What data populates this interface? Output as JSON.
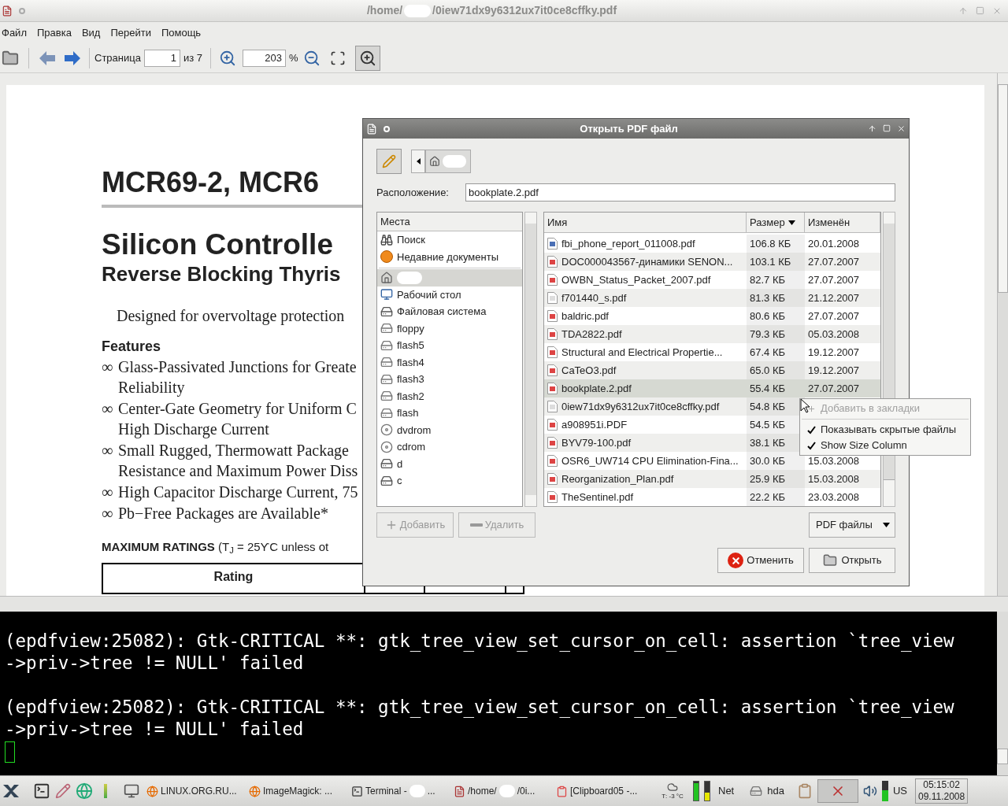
{
  "window": {
    "title_parts": [
      "/home/",
      "/0iew71dx9y6312ux7it0ce8cffky.pdf"
    ]
  },
  "menu": [
    "Файл",
    "Правка",
    "Вид",
    "Перейти",
    "Помощь"
  ],
  "toolbar": {
    "nav": [
      {
        "kind": "back",
        "disabled": true
      },
      {
        "kind": "forward",
        "disabled": false
      }
    ],
    "page_label": "Страница",
    "page": "1",
    "page_total": "из 7",
    "zoom": "203",
    "zoom_unit": "%",
    "fit": [
      {
        "kind": "page",
        "on": false
      },
      {
        "kind": "width",
        "on": true
      }
    ]
  },
  "document": {
    "heading": "MCR69-2, MCR6",
    "title": "Silicon Controlle",
    "subtitle": "Reverse Blocking Thyris",
    "intro": "Designed for overvoltage protection",
    "features_title": "Features",
    "features": [
      {
        "marker": "∞",
        "lines": [
          "Glass-Passivated Junctions for Greate",
          "Reliability"
        ]
      },
      {
        "marker": "∞",
        "lines": [
          "Center-Gate Geometry for Uniform C",
          "High Discharge Current"
        ]
      },
      {
        "marker": "∞",
        "lines": [
          "Small Rugged, Thermowatt Package",
          "Resistance and Maximum Power Diss"
        ]
      },
      {
        "marker": "∞",
        "lines": [
          "High Capacitor Discharge Current, 75"
        ]
      },
      {
        "marker": "∞",
        "lines": [
          "Pb−Free Packages are Available*"
        ]
      }
    ],
    "ratings": "**MAXIMUM RATINGS** (T$_{J}$ = 25ϒC unless ot",
    "table_header": "Rating"
  },
  "dialog": {
    "title": "Открыть PDF файл",
    "location_label": "Расположение:",
    "location": "bookplate.2.pdf",
    "places_header": "Места",
    "places": [
      {
        "kind": "search",
        "label": "Поиск",
        "selected": false
      },
      {
        "kind": "recent",
        "label": "Недавние документы",
        "selected": false
      },
      {
        "kind": "home",
        "selected": true
      },
      {
        "kind": "desktop",
        "label": "Рабочий стол",
        "selected": false
      },
      {
        "kind": "filesystem",
        "label": "Файловая система",
        "selected": false
      },
      {
        "kind": "drive",
        "label": "floppy",
        "selected": false
      },
      {
        "kind": "drive",
        "label": "flash5",
        "selected": false
      },
      {
        "kind": "drive",
        "label": "flash4",
        "selected": false
      },
      {
        "kind": "drive",
        "label": "flash3",
        "selected": false
      },
      {
        "kind": "drive",
        "label": "flash2",
        "selected": false
      },
      {
        "kind": "drive",
        "label": "flash",
        "selected": false
      },
      {
        "kind": "optical",
        "label": "dvdrom",
        "selected": false
      },
      {
        "kind": "optical",
        "label": "cdrom",
        "selected": false
      },
      {
        "kind": "filesystem",
        "label": "d",
        "selected": false
      },
      {
        "kind": "filesystem",
        "label": "c",
        "selected": false
      }
    ],
    "columns": [
      {
        "label": "Имя",
        "sorted": false
      },
      {
        "label": "Размер",
        "sorted": true
      },
      {
        "label": "Изменён",
        "sorted": false
      }
    ],
    "files": [
      {
        "kind": "other",
        "name": "fbi_phone_report_011008.pdf",
        "size": "106.8 КБ",
        "modified": "20.01.2008",
        "selected": false
      },
      {
        "kind": "pdf",
        "name": "DOC000043567-динамики SENON...",
        "size": "103.1 КБ",
        "modified": "27.07.2007",
        "selected": false
      },
      {
        "kind": "pdf",
        "name": "OWBN_Status_Packet_2007.pdf",
        "size": "82.7 КБ",
        "modified": "27.07.2007",
        "selected": false
      },
      {
        "kind": "blank",
        "name": "f701440_s.pdf",
        "size": "81.3 КБ",
        "modified": "21.12.2007",
        "selected": false
      },
      {
        "kind": "pdf",
        "name": "baldric.pdf",
        "size": "80.6 КБ",
        "modified": "27.07.2007",
        "selected": false
      },
      {
        "kind": "pdf",
        "name": "TDA2822.pdf",
        "size": "79.3 КБ",
        "modified": "05.03.2008",
        "selected": false
      },
      {
        "kind": "pdf",
        "name": "Structural and Electrical Propertie...",
        "size": "67.4 КБ",
        "modified": "19.12.2007",
        "selected": false
      },
      {
        "kind": "pdf",
        "name": "CaTeO3.pdf",
        "size": "65.0 КБ",
        "modified": "19.12.2007",
        "selected": false
      },
      {
        "kind": "pdf",
        "name": "bookplate.2.pdf",
        "size": "55.4 КБ",
        "modified": "27.07.2007",
        "selected": true
      },
      {
        "kind": "blank",
        "name": "0iew71dx9y6312ux7it0ce8cffky.pdf",
        "size": "54.8 КБ",
        "selected": false
      },
      {
        "kind": "pdf",
        "name": "a908951i.PDF",
        "size": "54.5 КБ",
        "selected": false
      },
      {
        "kind": "pdf",
        "name": "BYV79-100.pdf",
        "size": "38.1 КБ",
        "selected": false
      },
      {
        "kind": "pdf",
        "name": "OSR6_UW714 CPU Elimination-Fina...",
        "size": "30.0 КБ",
        "modified": "15.03.2008",
        "selected": false
      },
      {
        "kind": "pdf",
        "name": "Reorganization_Plan.pdf",
        "size": "25.9 КБ",
        "modified": "15.03.2008",
        "selected": false
      },
      {
        "kind": "pdf",
        "name": "TheSentinel.pdf",
        "size": "22.2 КБ",
        "modified": "23.03.2008",
        "selected": false
      }
    ],
    "add": {
      "label": "Добавить",
      "disabled": true
    },
    "remove": {
      "label": "Удалить",
      "disabled": true
    },
    "filter": "PDF файлы",
    "cancel": "Отменить",
    "open": "Открыть",
    "context_menu": [
      {
        "kind": "action",
        "label": "Добавить в закладки",
        "disabled": true
      },
      {
        "kind": "check",
        "label": "Показывать скрытые файлы",
        "checked": true
      },
      {
        "kind": "check",
        "label": "Show Size Column",
        "checked": true
      }
    ]
  },
  "terminal": {
    "messages": [
      {
        "lines": [
          "(epdfview:25082): Gtk-CRITICAL **: gtk_tree_view_set_cursor_on_cell: assertion `tree_view",
          "->priv->tree != NULL' failed"
        ]
      },
      {
        "lines": [
          "(epdfview:25082): Gtk-CRITICAL **: gtk_tree_view_set_cursor_on_cell: assertion `tree_view",
          "->priv->tree != NULL' failed"
        ]
      }
    ]
  },
  "taskbar": {
    "tasks": [
      {
        "kind": "browser",
        "parts": [
          "LINUX.ORG.RU..."
        ]
      },
      {
        "kind": "browser",
        "parts": [
          "ImageMagick: ..."
        ]
      },
      {
        "kind": "terminal",
        "parts": [
          "Terminal - ",
          "..."
        ]
      },
      {
        "kind": "viewer",
        "parts": [
          "/home/",
          "/0i..."
        ]
      },
      {
        "kind": "clipboard",
        "parts": [
          "[Clipboard05 -..."
        ]
      }
    ],
    "weather": "Т: -3 °C",
    "meters": [
      {
        "color": "#22c322",
        "level": 0.9
      },
      {
        "color": "#e6e600",
        "level": 0.4
      }
    ],
    "net": "Net",
    "disk": "hda",
    "volume": {
      "level": 0.55
    },
    "layout": "US",
    "time": "05:15:02",
    "date": "09.11.2008"
  }
}
